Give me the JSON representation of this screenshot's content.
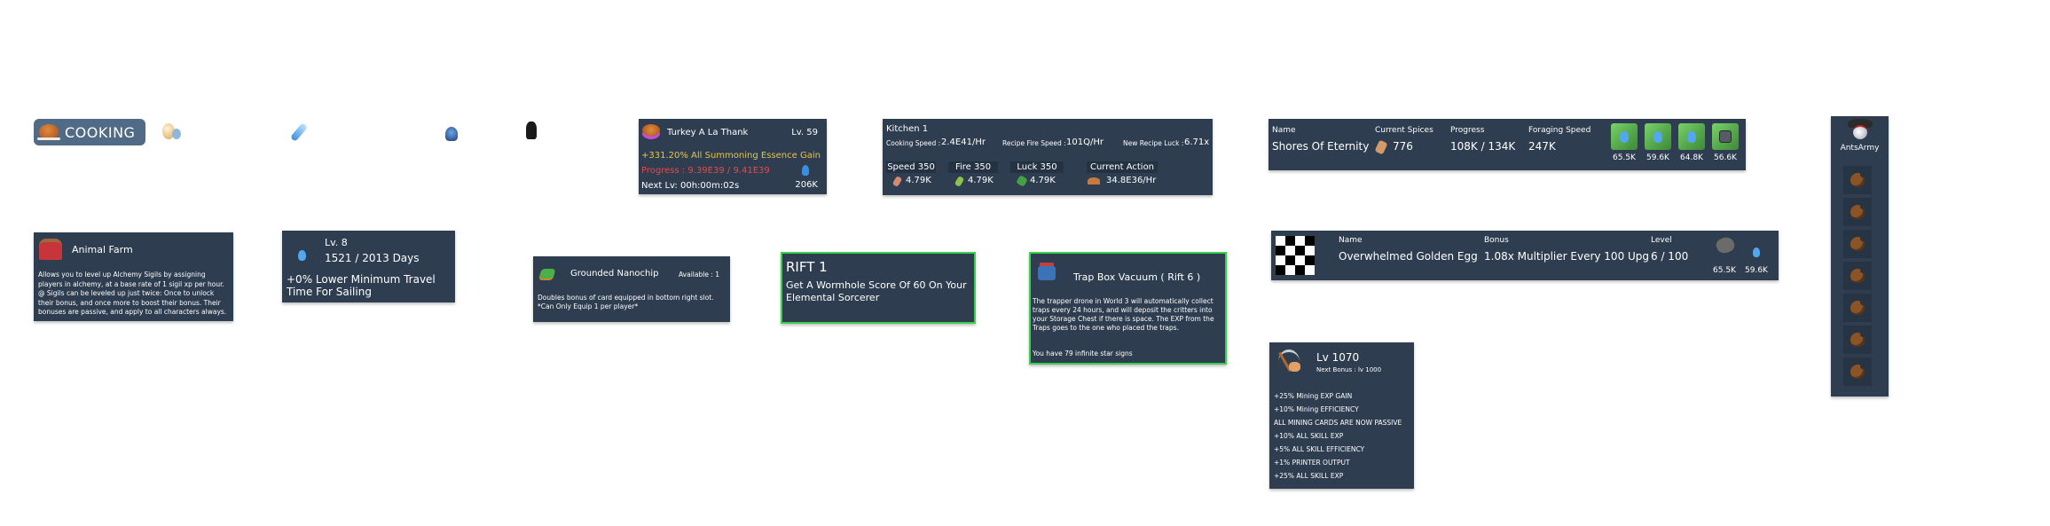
{
  "skill_badge": {
    "label": "COOKING",
    "icon": "roast-turkey-icon",
    "bg_color": "#516b87"
  },
  "top_icons": [
    "egg-cluster-icon",
    "blue-capsule-icon",
    "blue-crystal-icon",
    "black-obsidian-icon"
  ],
  "animal_farm": {
    "title": "Animal Farm",
    "icon": "red-barn-icon",
    "description": "Allows you to level up Alchemy Sigils by assigning players in alchemy, at a base rate of 1 sigil xp per hour. @ Sigils can be leveled up just twice: Once to unlock their bonus, and once more to boost their bonus. Their bonuses are passive, and apply to all characters always."
  },
  "sailing": {
    "level": "Lv. 8",
    "days": "1521 / 2013 Days",
    "bonus": "+0% Lower Minimum Travel Time For Sailing",
    "icon": "blue-bird-icon"
  },
  "nanochip": {
    "title": "Grounded Nanochip",
    "available": "Available : 1",
    "description": "Doubles bonus of card equipped in bottom right slot. *Can Only Equip 1 per player*",
    "icon": "green-chip-icon"
  },
  "meal": {
    "name": "Turkey A La Thank",
    "level": "Lv. 59",
    "bonus": "+331.20% All Summoning Essence Gain",
    "progress": "Progress : 9.39E39 / 9.41E39",
    "next_level": "Next Lv: 00h:00m:02s",
    "cost": "206K",
    "bonus_color": "#e8c547",
    "progress_color": "#e24b4b"
  },
  "rift": {
    "title": "RIFT 1",
    "description": "Get A Wormhole Score Of 60 On Your Elemental Sorcerer",
    "border_color": "#3ccf4e"
  },
  "kitchen": {
    "title": "Kitchen 1",
    "cooking_speed_label": "Cooking Speed :",
    "cooking_speed": "2.4E41/Hr",
    "fire_speed_label": "Recipe Fire Speed :",
    "fire_speed": "101Q/Hr",
    "luck_label": "New Recipe Luck :",
    "luck": "6.71x",
    "stats": [
      {
        "label": "Speed 350",
        "value": "4.79K",
        "icon": "pink-spice-icon"
      },
      {
        "label": "Fire 350",
        "value": "4.79K",
        "icon": "green-spice-icon"
      },
      {
        "label": "Luck 350",
        "value": "4.79K",
        "icon": "green-herb-icon"
      }
    ],
    "current_action_label": "Current Action",
    "current_action_value": "34.8E36/Hr"
  },
  "trap_box": {
    "title": "Trap Box Vacuum ( Rift 6 )",
    "description": "The trapper drone in World 3 will automatically collect traps every 24 hours, and will deposit the critters into your Storage Chest if there is space. The EXP from the Traps goes to the one who placed the traps.",
    "star_signs": "You have 79 infinite star signs"
  },
  "spice_island": {
    "name_label": "Name",
    "name": "Shores Of Eternity",
    "spices_label": "Current Spices",
    "spices": "776",
    "progress_label": "Progress",
    "progress": "108K / 134K",
    "foraging_label": "Foraging Speed",
    "foraging": "247K",
    "foragers": [
      {
        "value": "65.5K",
        "icon": "blue-bird-icon"
      },
      {
        "value": "59.6K",
        "icon": "blue-bird-icon"
      },
      {
        "value": "64.8K",
        "icon": "blue-bird-icon"
      },
      {
        "value": "56.6K",
        "icon": "gray-robot-icon"
      }
    ]
  },
  "golden_egg": {
    "name_label": "Name",
    "name": "Overwhelmed Golden Egg",
    "bonus_label": "Bonus",
    "bonus": "1.08x Multiplier Every 100 Upg",
    "level_label": "Level",
    "level": "6 / 100",
    "costs": [
      {
        "value": "65.5K",
        "icon": "gray-rock-icon"
      },
      {
        "value": "59.6K",
        "icon": "blue-bird-icon"
      }
    ]
  },
  "mining": {
    "level": "Lv 1070",
    "next_bonus": "Next Bonus : lv 1000",
    "bonuses": [
      "+25% Mining EXP GAIN",
      "+10% Mining EFFICIENCY",
      "ALL MINING CARDS ARE NOW PASSIVE",
      "+10% ALL SKILL EXP",
      "+5% ALL SKILL EFFICIENCY",
      "+1% PRINTER OUTPUT",
      "+25% ALL SKILL EXP"
    ]
  },
  "character": {
    "name": "AntsArmy",
    "icon": "pirate-hat-icon",
    "slots": [
      "cookie-icon",
      "cookie-icon",
      "cookie-icon",
      "cookie-icon",
      "cookie-icon",
      "cookie-icon",
      "cookie-icon"
    ]
  }
}
